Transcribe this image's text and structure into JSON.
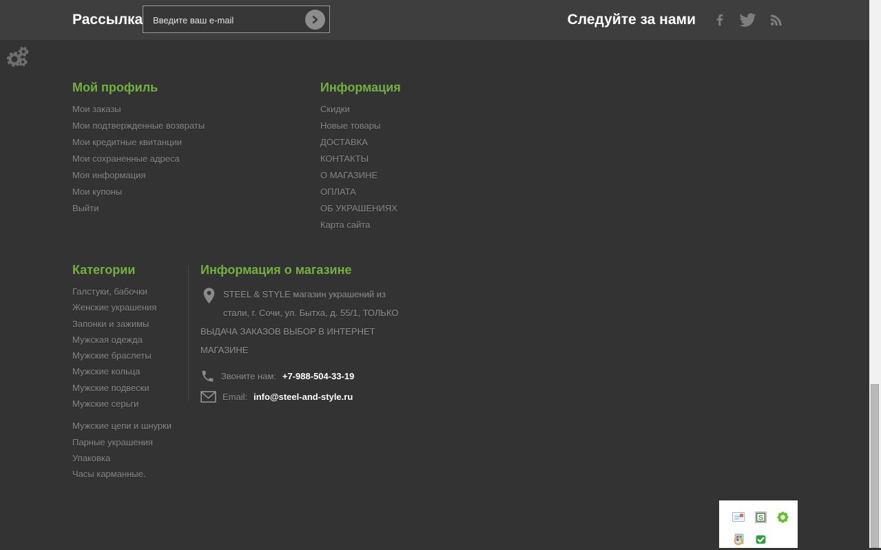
{
  "page": {
    "background": "#333333",
    "topbar_background": "#3e3e3e",
    "accent_green": "#72b13d",
    "link_gray": "#878787",
    "icon_gray": "#7e7e7e",
    "scrollbar_track": "#f1f1f1",
    "scrollbar_thumb": "#b9b9b9"
  },
  "newsletter": {
    "title": "Рассылка",
    "placeholder": "Введите ваш e-mail",
    "submit_icon": "arrow-right-circle-icon"
  },
  "follow": {
    "title": "Следуйте за нами",
    "icons": [
      "facebook-icon",
      "twitter-icon",
      "rss-icon"
    ]
  },
  "settings_widget": {
    "icon": "gears-icon"
  },
  "profile": {
    "title": "Мой профиль",
    "links": [
      "Мои заказы",
      "Мои подтвержденные возвраты",
      "Мои кредитные квитанции",
      "Мои сохраненные адреса",
      "Моя информация",
      "Мои купоны",
      "Выйти"
    ]
  },
  "information": {
    "title": "Информация",
    "links": [
      "Скидки",
      "Новые товары",
      "ДОСТАВКА",
      "КОНТАКТЫ",
      "О МАГАЗИНЕ",
      "ОПЛАТА",
      "ОБ УКРАШЕНИЯХ",
      "Карта сайта"
    ]
  },
  "categories": {
    "title": "Категории",
    "group1": [
      "Галстуки, бабочки",
      "Женские украшения",
      "Запонки и зажимы",
      "Мужская одежда",
      "Мужские браслеты",
      "Мужские кольца",
      "Мужские подвески",
      "Мужские серьги"
    ],
    "group2": [
      "Мужские цепи и шнурки",
      "Парные украшения",
      "Упаковка",
      "Часы карманные."
    ]
  },
  "store": {
    "title": "Информация о магазине",
    "address": "STEEL & STYLE магазин украшений из стали, г. Сочи, ул. Бытха, д. 55/1, ТОЛЬКО ВЫДАЧА ЗАКАЗОВ ВЫБОР В ИНТЕРНЕТ МАГАЗИНЕ",
    "phone_label": "Звоните нам:",
    "phone_number": "+7-988-504-33-19",
    "email_label": "Email:",
    "email_address": "info@steel-and-style.ru"
  },
  "messenger_panel": {
    "icons": [
      "email-letter-icon",
      "s-badge-icon",
      "icq-flower-icon",
      "msn-messenger-icon",
      "agent-check-icon"
    ],
    "s_label": "S"
  }
}
